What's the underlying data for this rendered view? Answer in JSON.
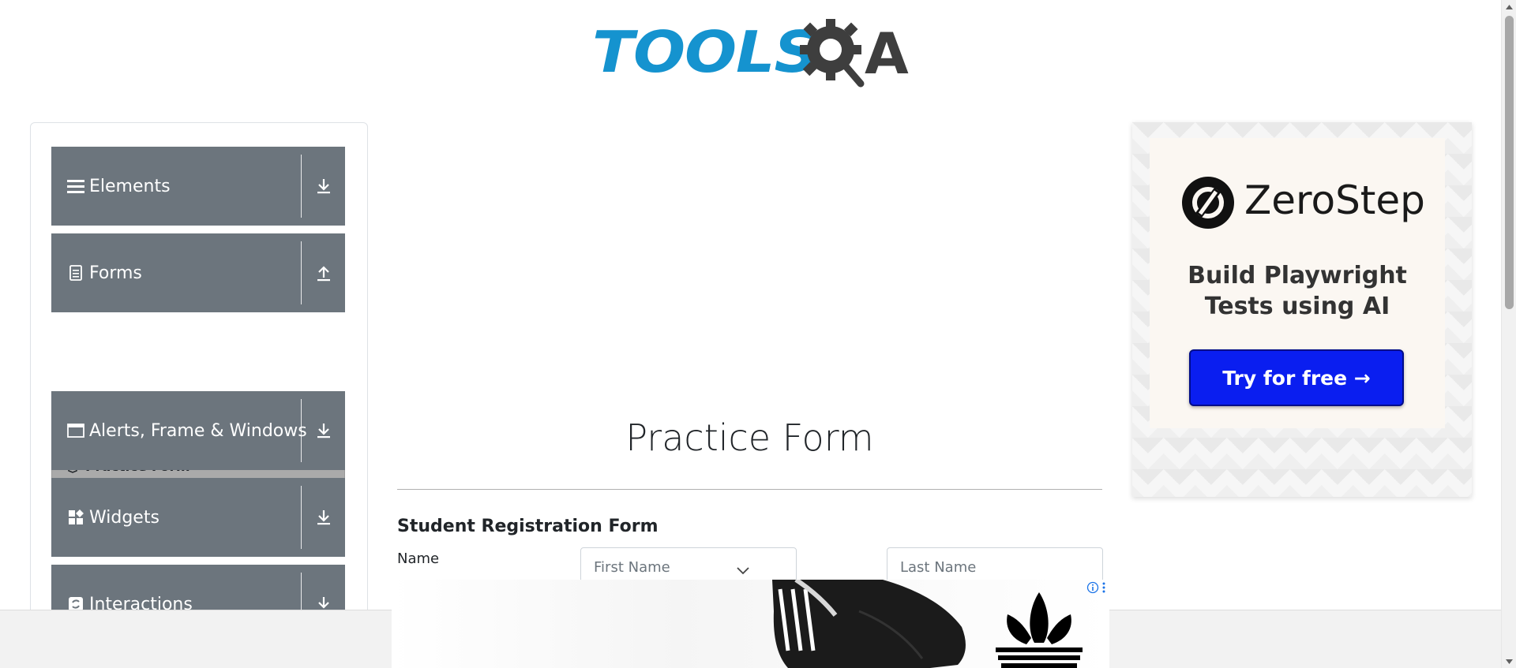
{
  "header": {
    "logo_text": "TOOLSQA",
    "logo_part1": "TOOLS",
    "logo_part2": "A"
  },
  "sidebar": {
    "groups": [
      {
        "label": "Elements",
        "icon": "hamburger-icon",
        "state": "collapsed"
      },
      {
        "label": "Forms",
        "icon": "document-icon",
        "state": "expanded"
      },
      {
        "label": "Alerts, Frame & Windows",
        "icon": "window-icon",
        "state": "collapsed"
      },
      {
        "label": "Widgets",
        "icon": "widgets-icon",
        "state": "collapsed"
      },
      {
        "label": "Interactions",
        "icon": "interactions-icon",
        "state": "collapsed"
      }
    ],
    "forms_items": [
      {
        "label": "Practice Form",
        "icon": "html5-icon",
        "active": true
      }
    ]
  },
  "main": {
    "title": "Practice Form",
    "form_heading": "Student Registration Form",
    "name_label": "Name",
    "first_name": {
      "value": "",
      "placeholder": "First Name"
    },
    "last_name": {
      "value": "",
      "placeholder": "Last Name"
    }
  },
  "ad_right": {
    "brand": "ZeroStep",
    "tagline": "Build Playwright Tests using AI",
    "cta": "Try for free →"
  },
  "colors": {
    "sidebar_bg": "#6c757d",
    "active_item_bg": "#aaaaaa",
    "logo_blue": "#1593cf",
    "logo_dark": "#3e3e3e",
    "cta_blue": "#0a1ef0"
  }
}
